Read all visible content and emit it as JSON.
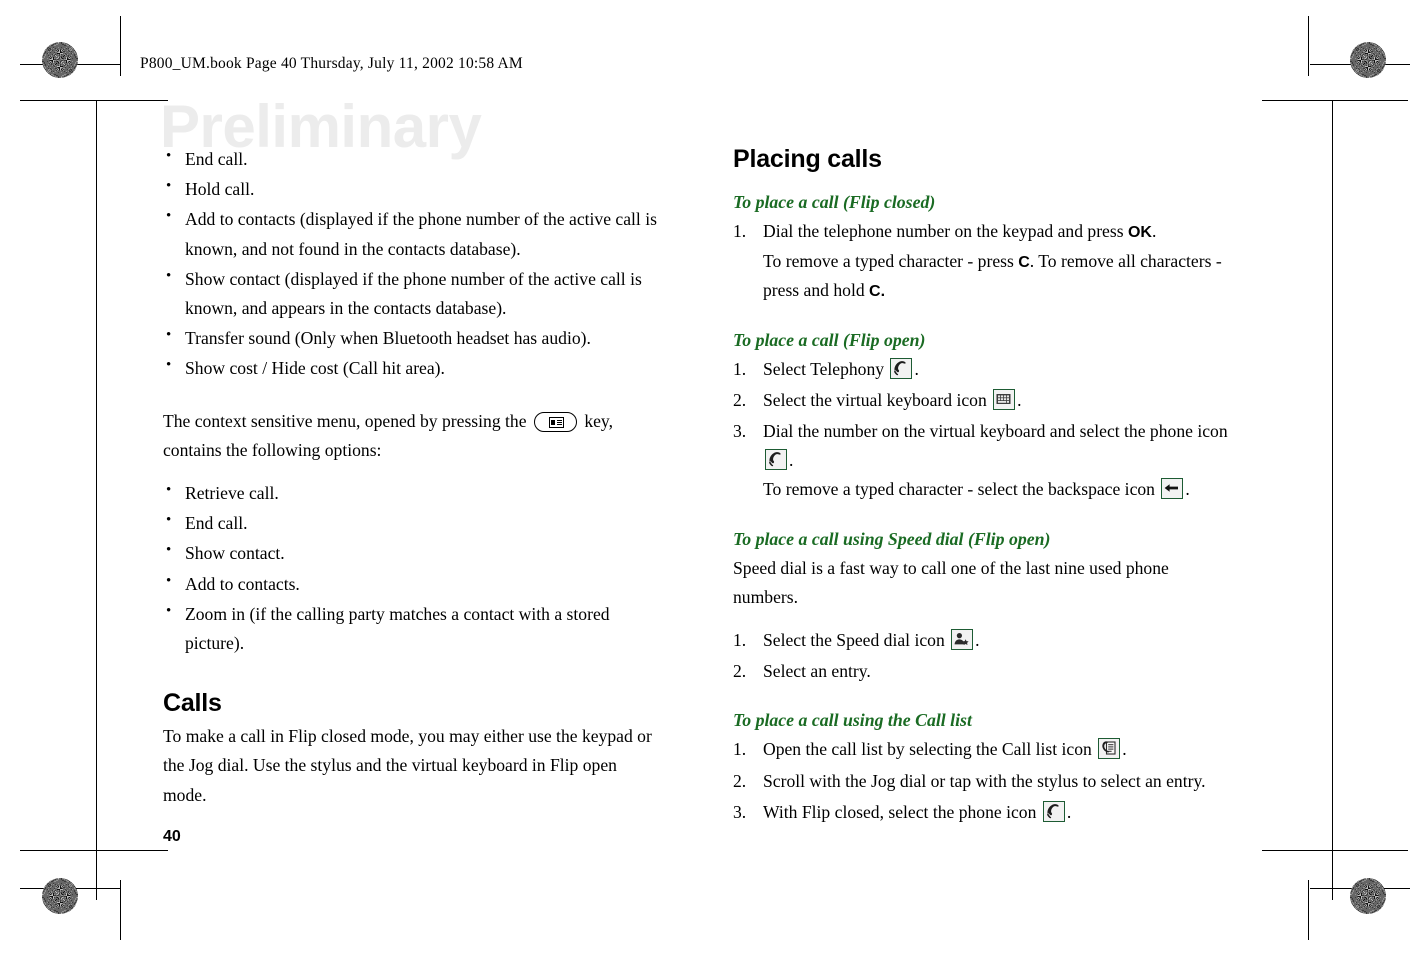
{
  "page": {
    "header_slug": "P800_UM.book  Page 40  Thursday, July 11, 2002  10:58 AM",
    "watermark": "Preliminary",
    "page_number": "40",
    "accent_green": "#1a6b23",
    "icon_border_green": "#1d5b33"
  },
  "left_column": {
    "bullets_top": [
      "End call.",
      "Hold call.",
      "Add to contacts (displayed if the phone number of the active call is known, and not found in the contacts database).",
      "Show contact (displayed if the phone number of the active call is known, and appears in the contacts database).",
      "Transfer sound (Only when Bluetooth headset has audio).",
      "Show cost / Hide cost (Call hit area)."
    ],
    "context_menu_paragraph": {
      "before_icon": "The context sensitive menu, opened by pressing the",
      "icon": "menu-key-icon",
      "after_icon": "key, contains the following options:"
    },
    "bullets_menu": [
      "Retrieve call.",
      "End call.",
      "Show contact.",
      "Add to contacts.",
      "Zoom in (if the calling party matches a contact with a stored picture)."
    ],
    "calls_section": {
      "heading": "Calls",
      "paragraph": "To make a call in Flip closed mode, you may either use the keypad or the Jog dial. Use the stylus and the virtual keyboard in Flip open mode."
    }
  },
  "right_column": {
    "heading": "Placing calls",
    "sub_flip_closed": {
      "heading": "To place a call (Flip closed)",
      "step1": {
        "part1": "Dial the telephone number on the keypad and press ",
        "key_ok": "OK",
        "part2": ".",
        "part3": "To remove a typed character - press ",
        "key_c1": "C",
        "part4": ". To remove all characters - press and hold ",
        "key_c2": "C."
      }
    },
    "sub_flip_open": {
      "heading": "To place a call (Flip open)",
      "step1_before": "Select Telephony",
      "step1_icon": "phone-handset-icon",
      "step1_after": ".",
      "step2_before": "Select the virtual keyboard icon",
      "step2_icon": "virtual-keyboard-icon",
      "step2_after": ".",
      "step3_before": "Dial the number on the virtual keyboard and select the phone icon",
      "step3_icon": "phone-handset-icon",
      "step3_after": ".",
      "step3_line2_before": "To remove a typed character - select the backspace icon",
      "step3_line2_icon": "backspace-arrow-icon",
      "step3_line2_after": "."
    },
    "sub_speed_dial": {
      "heading": "To place a call using Speed dial (Flip open)",
      "paragraph": "Speed dial is a fast way to call one of the last nine used phone numbers.",
      "step1_before": "Select the Speed dial icon",
      "step1_icon": "speed-dial-icon",
      "step1_after": ".",
      "step2": "Select an entry."
    },
    "sub_call_list": {
      "heading": "To place a call using the Call list",
      "step1_before": "Open the call list by selecting the Call list icon",
      "step1_icon": "call-list-icon",
      "step1_after": ".",
      "step2": "Scroll with the Jog dial or tap with the stylus to select an entry.",
      "step3_before": "With Flip closed, select the phone icon",
      "step3_icon": "phone-handset-icon",
      "step3_after": "."
    }
  }
}
